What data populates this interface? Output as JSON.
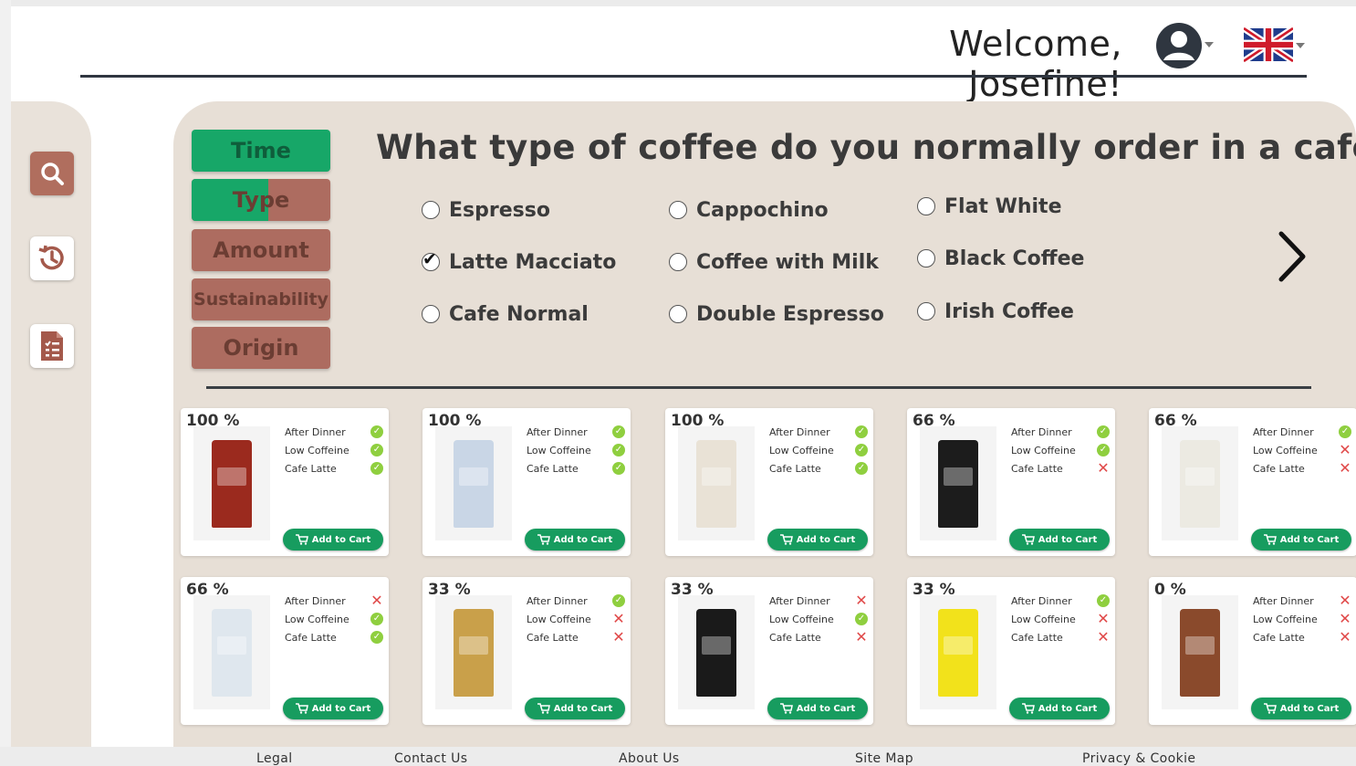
{
  "header": {
    "welcome": "Welcome, Josefine!",
    "account_icon": "user-circle-icon",
    "language_icon": "uk-flag-icon"
  },
  "sidebar": {
    "items": [
      {
        "name": "search",
        "icon": "search-icon",
        "color": "#b06e5e"
      },
      {
        "name": "history",
        "icon": "history-icon"
      },
      {
        "name": "report",
        "icon": "checklist-document-icon"
      }
    ]
  },
  "tabs": [
    {
      "label": "Time",
      "state": "complete",
      "progress": 1.0
    },
    {
      "label": "Type",
      "state": "in-progress",
      "progress": 0.55
    },
    {
      "label": "Amount",
      "state": "pending",
      "progress": 0
    },
    {
      "label": "Sustainability",
      "state": "pending",
      "progress": 0
    },
    {
      "label": "Origin",
      "state": "pending",
      "progress": 0
    }
  ],
  "question": "What type of coffee do you normally order in a cafe?",
  "options": [
    {
      "label": "Espresso",
      "checked": false
    },
    {
      "label": "Cappochino",
      "checked": false
    },
    {
      "label": "Flat White",
      "checked": false
    },
    {
      "label": "Latte Macciato",
      "checked": true
    },
    {
      "label": "Coffee with Milk",
      "checked": false
    },
    {
      "label": "Black Coffee",
      "checked": false
    },
    {
      "label": "Cafe Normal",
      "checked": false
    },
    {
      "label": "Double Espresso",
      "checked": false
    },
    {
      "label": "Irish Coffee",
      "checked": false
    }
  ],
  "attribute_labels": [
    "After Dinner",
    "Low Coffeine",
    "Cafe Latte"
  ],
  "cart_label": "Add to Cart",
  "products": [
    {
      "match": "100 %",
      "attrs": [
        true,
        true,
        true
      ],
      "bag_color": "#9b2a1e"
    },
    {
      "match": "100 %",
      "attrs": [
        true,
        true,
        true
      ],
      "bag_color": "#c9d6e6"
    },
    {
      "match": "100 %",
      "attrs": [
        true,
        true,
        true
      ],
      "bag_color": "#e9e2d6"
    },
    {
      "match": "66 %",
      "attrs": [
        true,
        true,
        false
      ],
      "bag_color": "#1c1c1c"
    },
    {
      "match": "66 %",
      "attrs": [
        true,
        false,
        false
      ],
      "bag_color": "#eceae2"
    },
    {
      "match": "66 %",
      "attrs": [
        false,
        true,
        true
      ],
      "bag_color": "#dfe7ee"
    },
    {
      "match": "33 %",
      "attrs": [
        true,
        false,
        false
      ],
      "bag_color": "#c9a04a"
    },
    {
      "match": "33 %",
      "attrs": [
        false,
        true,
        false
      ],
      "bag_color": "#1a1a1a"
    },
    {
      "match": "33 %",
      "attrs": [
        true,
        false,
        false
      ],
      "bag_color": "#f2e21b"
    },
    {
      "match": "0 %",
      "attrs": [
        false,
        false,
        false
      ],
      "bag_color": "#8a4a2c"
    }
  ],
  "footer": {
    "links": [
      "Legal",
      "Contact Us",
      "About Us",
      "Site Map",
      "Privacy & Cookie"
    ]
  },
  "colors": {
    "accent_green": "#17a768",
    "accent_brown": "#ad6c60",
    "panel": "#e7dfd6",
    "check_ok": "#8fcf3f",
    "cross": "#e04848"
  }
}
